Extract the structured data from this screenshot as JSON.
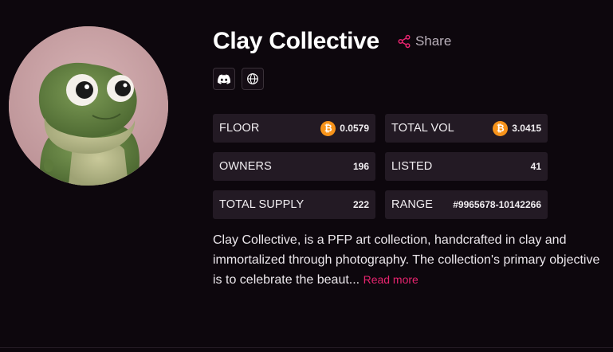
{
  "collection": {
    "title": "Clay Collective",
    "share_label": "Share",
    "avatar_alt": "clay-frog-avatar"
  },
  "socials": [
    {
      "icon": "discord-icon"
    },
    {
      "icon": "globe-icon"
    }
  ],
  "stats": {
    "floor": {
      "label": "FLOOR",
      "value": "0.0579",
      "icon": "bitcoin-icon"
    },
    "total_vol": {
      "label": "TOTAL VOL",
      "value": "3.0415",
      "icon": "bitcoin-icon"
    },
    "owners": {
      "label": "OWNERS",
      "value": "196"
    },
    "listed": {
      "label": "LISTED",
      "value": "41"
    },
    "total_supply": {
      "label": "TOTAL SUPPLY",
      "value": "222"
    },
    "range": {
      "label": "RANGE",
      "value": "#9965678-10142266"
    }
  },
  "description": {
    "text": "Clay Collective, is a PFP art collection, handcrafted in clay and immortalized through photography. The collection's primary objective is to celebrate the beaut...",
    "read_more": "Read more"
  },
  "colors": {
    "background": "#0d070d",
    "card": "#231a24",
    "accent": "#e8246f",
    "bitcoin": "#f7931a"
  }
}
